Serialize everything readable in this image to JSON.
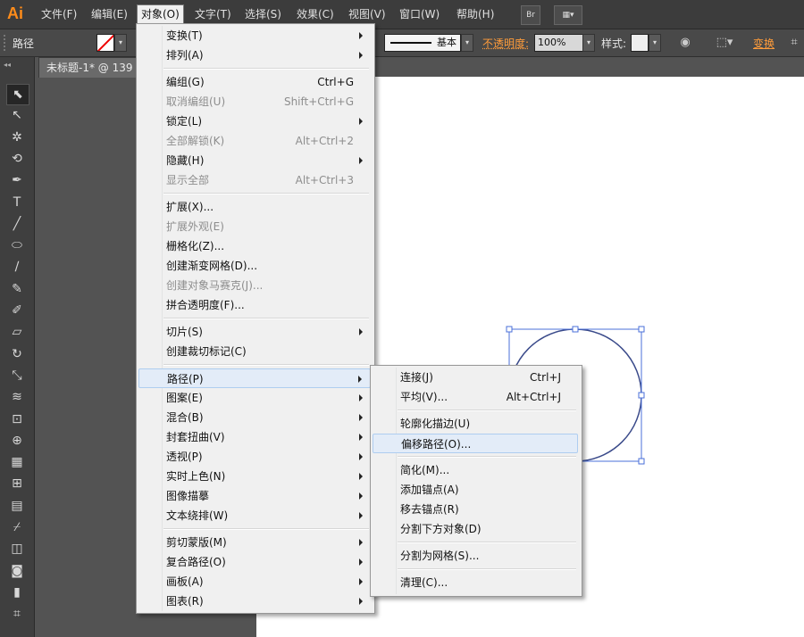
{
  "app": {
    "logo": "Ai",
    "accent": "#ff8c1a"
  },
  "menubar": {
    "items": [
      "文件(F)",
      "编辑(E)",
      "对象(O)",
      "文字(T)",
      "选择(S)",
      "效果(C)",
      "视图(V)",
      "窗口(W)",
      "帮助(H)"
    ],
    "active_index": 2,
    "bridge_label": "Br"
  },
  "controlbar": {
    "title": "路径",
    "stroke_style": "基本",
    "opacity_label": "不透明度:",
    "opacity_value": "100%",
    "style_label": "样式:",
    "transform_label": "变换"
  },
  "document": {
    "tab_title": "未标题-1* @ 139"
  },
  "object_menu": [
    {
      "label": "变换(T)",
      "submenu": true
    },
    {
      "label": "排列(A)",
      "submenu": true
    },
    {
      "sep": true
    },
    {
      "label": "编组(G)",
      "shortcut": "Ctrl+G"
    },
    {
      "label": "取消编组(U)",
      "shortcut": "Shift+Ctrl+G",
      "disabled": true
    },
    {
      "label": "锁定(L)",
      "submenu": true
    },
    {
      "label": "全部解锁(K)",
      "shortcut": "Alt+Ctrl+2",
      "disabled": true
    },
    {
      "label": "隐藏(H)",
      "submenu": true
    },
    {
      "label": "显示全部",
      "shortcut": "Alt+Ctrl+3",
      "disabled": true
    },
    {
      "sep": true
    },
    {
      "label": "扩展(X)..."
    },
    {
      "label": "扩展外观(E)",
      "disabled": true
    },
    {
      "label": "栅格化(Z)..."
    },
    {
      "label": "创建渐变网格(D)..."
    },
    {
      "label": "创建对象马赛克(J)...",
      "disabled": true
    },
    {
      "label": "拼合透明度(F)..."
    },
    {
      "sep": true
    },
    {
      "label": "切片(S)",
      "submenu": true
    },
    {
      "label": "创建裁切标记(C)"
    },
    {
      "sep": true
    },
    {
      "label": "路径(P)",
      "submenu": true,
      "highlighted": true
    },
    {
      "label": "图案(E)",
      "submenu": true
    },
    {
      "label": "混合(B)",
      "submenu": true
    },
    {
      "label": "封套扭曲(V)",
      "submenu": true
    },
    {
      "label": "透视(P)",
      "submenu": true
    },
    {
      "label": "实时上色(N)",
      "submenu": true
    },
    {
      "label": "图像描摹",
      "submenu": true
    },
    {
      "label": "文本绕排(W)",
      "submenu": true
    },
    {
      "sep": true
    },
    {
      "label": "剪切蒙版(M)",
      "submenu": true
    },
    {
      "label": "复合路径(O)",
      "submenu": true
    },
    {
      "label": "画板(A)",
      "submenu": true
    },
    {
      "label": "图表(R)",
      "submenu": true
    }
  ],
  "path_submenu": [
    {
      "label": "连接(J)",
      "shortcut": "Ctrl+J"
    },
    {
      "label": "平均(V)...",
      "shortcut": "Alt+Ctrl+J"
    },
    {
      "sep": true
    },
    {
      "label": "轮廓化描边(U)"
    },
    {
      "label": "偏移路径(O)...",
      "highlighted": true
    },
    {
      "sep": true
    },
    {
      "label": "简化(M)..."
    },
    {
      "label": "添加锚点(A)"
    },
    {
      "label": "移去锚点(R)"
    },
    {
      "label": "分割下方对象(D)"
    },
    {
      "sep": true
    },
    {
      "label": "分割为网格(S)..."
    },
    {
      "sep": true
    },
    {
      "label": "清理(C)..."
    }
  ],
  "tools": [
    {
      "icon": "selection-tool-icon",
      "glyph": "⬉",
      "selected": true
    },
    {
      "icon": "direct-selection-tool-icon",
      "glyph": "↖"
    },
    {
      "icon": "magic-wand-tool-icon",
      "glyph": "✲"
    },
    {
      "icon": "lasso-tool-icon",
      "glyph": "⟲"
    },
    {
      "icon": "pen-tool-icon",
      "glyph": "✒"
    },
    {
      "icon": "type-tool-icon",
      "glyph": "T"
    },
    {
      "icon": "line-tool-icon",
      "glyph": "╱"
    },
    {
      "icon": "ellipse-tool-icon",
      "glyph": "⬭"
    },
    {
      "icon": "paintbrush-tool-icon",
      "glyph": "∕"
    },
    {
      "icon": "pencil-tool-icon",
      "glyph": "✎"
    },
    {
      "icon": "blob-brush-tool-icon",
      "glyph": "✐"
    },
    {
      "icon": "eraser-tool-icon",
      "glyph": "▱"
    },
    {
      "icon": "rotate-tool-icon",
      "glyph": "↻"
    },
    {
      "icon": "scale-tool-icon",
      "glyph": "⤡"
    },
    {
      "icon": "width-tool-icon",
      "glyph": "≋"
    },
    {
      "icon": "free-transform-tool-icon",
      "glyph": "⊡"
    },
    {
      "icon": "shape-builder-tool-icon",
      "glyph": "⊕"
    },
    {
      "icon": "perspective-grid-tool-icon",
      "glyph": "▦"
    },
    {
      "icon": "mesh-tool-icon",
      "glyph": "⊞"
    },
    {
      "icon": "gradient-tool-icon",
      "glyph": "▤"
    },
    {
      "icon": "eyedropper-tool-icon",
      "glyph": "⌿"
    },
    {
      "icon": "blend-tool-icon",
      "glyph": "◫"
    },
    {
      "icon": "symbol-sprayer-tool-icon",
      "glyph": "◙"
    },
    {
      "icon": "column-graph-tool-icon",
      "glyph": "▮"
    },
    {
      "icon": "artboard-tool-icon",
      "glyph": "⌗"
    }
  ]
}
